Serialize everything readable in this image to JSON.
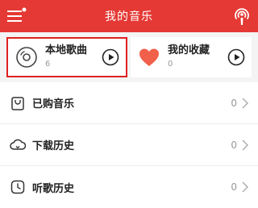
{
  "header": {
    "title": "我的音乐",
    "icons": {
      "menu": "menu-icon",
      "right": "podcast-icon"
    }
  },
  "cards": {
    "local": {
      "name": "本地歌曲",
      "count": "6",
      "icon": "disc-icon"
    },
    "favorites": {
      "name": "我的收藏",
      "count": "0",
      "icon": "heart-icon"
    }
  },
  "list": [
    {
      "label": "已购音乐",
      "count": "0",
      "icon": "bag-icon"
    },
    {
      "label": "下载历史",
      "count": "0",
      "icon": "cloud-download-icon"
    },
    {
      "label": "听歌历史",
      "count": "0",
      "icon": "clock-icon"
    }
  ],
  "colors": {
    "accent": "#e53935",
    "highlight_border": "#e02020",
    "heart": "#f0604a"
  }
}
